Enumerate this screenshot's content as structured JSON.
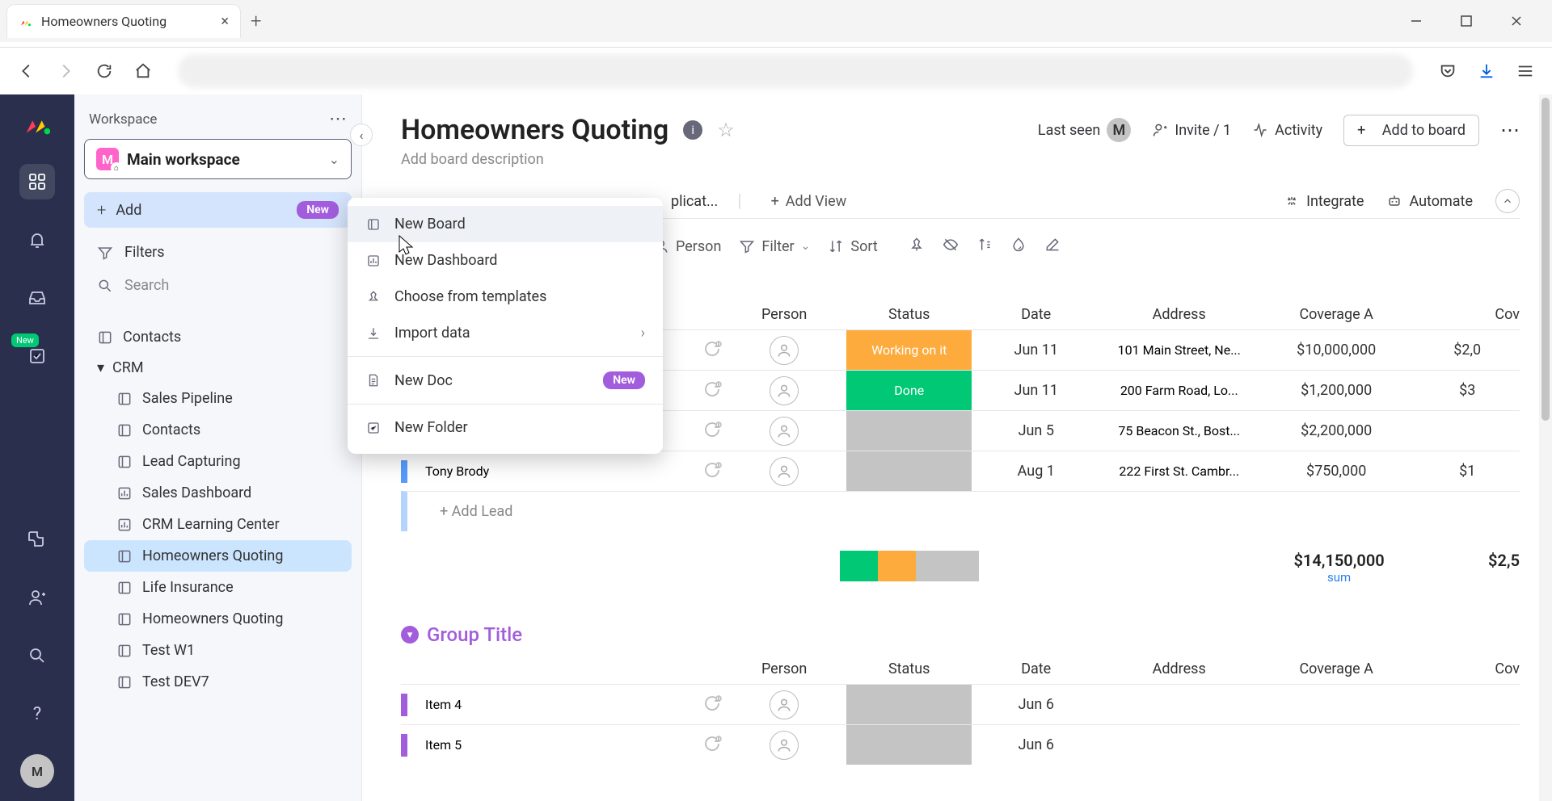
{
  "browser": {
    "tab_title": "Homeowners Quoting"
  },
  "sidebar": {
    "header": "Workspace",
    "workspace_letter": "M",
    "workspace_name": "Main workspace",
    "add_label": "Add",
    "add_badge": "New",
    "filters_label": "Filters",
    "search_placeholder": "Search",
    "boards": [
      {
        "label": "Contacts"
      },
      {
        "label": "CRM",
        "folder": true
      },
      {
        "label": "Sales Pipeline"
      },
      {
        "label": "Contacts"
      },
      {
        "label": "Lead Capturing"
      },
      {
        "label": "Sales Dashboard"
      },
      {
        "label": "CRM Learning Center"
      },
      {
        "label": "Homeowners Quoting",
        "active": true
      },
      {
        "label": "Life Insurance"
      },
      {
        "label": "Homeowners Quoting"
      },
      {
        "label": "Test W1"
      },
      {
        "label": "Test DEV7"
      }
    ]
  },
  "rail": {
    "new_badge": "New",
    "avatar": "M"
  },
  "header": {
    "title": "Homeowners Quoting",
    "description": "Add board description",
    "last_seen": "Last seen",
    "avatar": "M",
    "invite": "Invite / 1",
    "activity": "Activity",
    "add_to_board": "Add to board"
  },
  "tabs": {
    "partial_tab": "plicat...",
    "add_view": "Add View",
    "integrate": "Integrate",
    "automate": "Automate"
  },
  "toolbar": {
    "person": "Person",
    "filter": "Filter",
    "sort": "Sort"
  },
  "table": {
    "columns": {
      "person": "Person",
      "status": "Status",
      "date": "Date",
      "address": "Address",
      "covA": "Coverage A",
      "covB": "Cov"
    },
    "rows": [
      {
        "name": "",
        "status": "Working on it",
        "status_class": "status-working",
        "date": "Jun 11",
        "address": "101 Main Street, Ne...",
        "covA": "$10,000,000",
        "covB": "$2,0"
      },
      {
        "name": "",
        "status": "Done",
        "status_class": "status-done",
        "date": "Jun 11",
        "address": "200 Farm Road, Lo...",
        "covA": "$1,200,000",
        "covB": "$3"
      },
      {
        "name": "Manny Hernandez",
        "status": "",
        "status_class": "status-empty",
        "date": "Jun 5",
        "address": "75 Beacon St., Bost...",
        "covA": "$2,200,000",
        "covB": ""
      },
      {
        "name": "Tony Brody",
        "status": "",
        "status_class": "status-empty",
        "date": "Aug 1",
        "address": "222 First St. Cambr...",
        "covA": "$750,000",
        "covB": "$1"
      }
    ],
    "add_lead": "+ Add Lead",
    "sum_covA": "$14,150,000",
    "sum_label": "sum",
    "sum_covB": "$2,5"
  },
  "group2": {
    "title": "Group Title",
    "columns": {
      "person": "Person",
      "status": "Status",
      "date": "Date",
      "address": "Address",
      "covA": "Coverage A",
      "covB": "Cov"
    },
    "rows": [
      {
        "name": "Item 4",
        "date": "Jun 6"
      },
      {
        "name": "Item 5",
        "date": "Jun 6"
      }
    ]
  },
  "popup": {
    "items": [
      {
        "label": "New Board",
        "icon": "board"
      },
      {
        "label": "New Dashboard",
        "icon": "dashboard"
      },
      {
        "label": "Choose from templates",
        "icon": "template"
      },
      {
        "label": "Import data",
        "icon": "import",
        "chevron": true
      },
      {
        "sep": true
      },
      {
        "label": "New Doc",
        "icon": "doc",
        "new": true
      },
      {
        "sep": true
      },
      {
        "label": "New Folder",
        "icon": "folder"
      }
    ],
    "new_badge": "New"
  }
}
